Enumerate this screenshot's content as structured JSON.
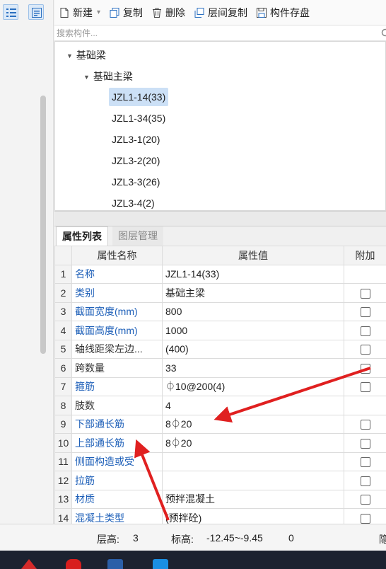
{
  "toolbar": {
    "new_label": "新建",
    "copy_label": "复制",
    "delete_label": "删除",
    "layer_copy_label": "层间复制",
    "save_label": "构件存盘"
  },
  "search": {
    "placeholder": "搜索构件..."
  },
  "tree": {
    "root": "基础梁",
    "child": "基础主梁",
    "leaves": [
      "JZL1-14(33)",
      "JZL1-34(35)",
      "JZL3-1(20)",
      "JZL3-2(20)",
      "JZL3-3(26)",
      "JZL3-4(2)"
    ],
    "selected": "JZL1-14(33)"
  },
  "tabs": [
    "属性列表",
    "图层管理"
  ],
  "grid": {
    "headers": [
      "",
      "属性名称",
      "属性值",
      "附加"
    ],
    "rows": [
      {
        "num": "1",
        "name": "名称",
        "value": "JZL1-14(33)",
        "checkbox": false
      },
      {
        "num": "2",
        "name": "类别",
        "value": "基础主梁",
        "checkbox": true
      },
      {
        "num": "3",
        "name": "截面宽度(mm)",
        "value": "800",
        "checkbox": true
      },
      {
        "num": "4",
        "name": "截面高度(mm)",
        "value": "1000",
        "checkbox": true
      },
      {
        "num": "5",
        "name": "轴线距梁左边...",
        "value": "(400)",
        "checkbox": true
      },
      {
        "num": "6",
        "name": "跨数量",
        "value": "33",
        "checkbox": true
      },
      {
        "num": "7",
        "name": "箍筋",
        "value": "⏀10@200(4)",
        "checkbox": true
      },
      {
        "num": "8",
        "name": "肢数",
        "value": "4",
        "checkbox": false
      },
      {
        "num": "9",
        "name": "下部通长筋",
        "value": "8⏀20",
        "checkbox": true
      },
      {
        "num": "10",
        "name": "上部通长筋",
        "value": "8⏀20",
        "checkbox": true
      },
      {
        "num": "11",
        "name": "侧面构造或受",
        "value": "",
        "checkbox": true
      },
      {
        "num": "12",
        "name": "拉筋",
        "value": "",
        "checkbox": true
      },
      {
        "num": "13",
        "name": "材质",
        "value": "预拌混凝土",
        "checkbox": true
      },
      {
        "num": "14",
        "name": "混凝土类型",
        "value": "(预拌砼)",
        "checkbox": true
      }
    ]
  },
  "status": {
    "floor_height_label": "层高:",
    "floor_height_value": "3",
    "elevation_label": "标高:",
    "elevation_value": "-12.45~-9.45",
    "extra_value": "0",
    "right_text": "隐"
  },
  "colors": {
    "accent": "#1d5fb8",
    "annotation_arrow": "#e02020",
    "selection": "#cce0f6"
  }
}
